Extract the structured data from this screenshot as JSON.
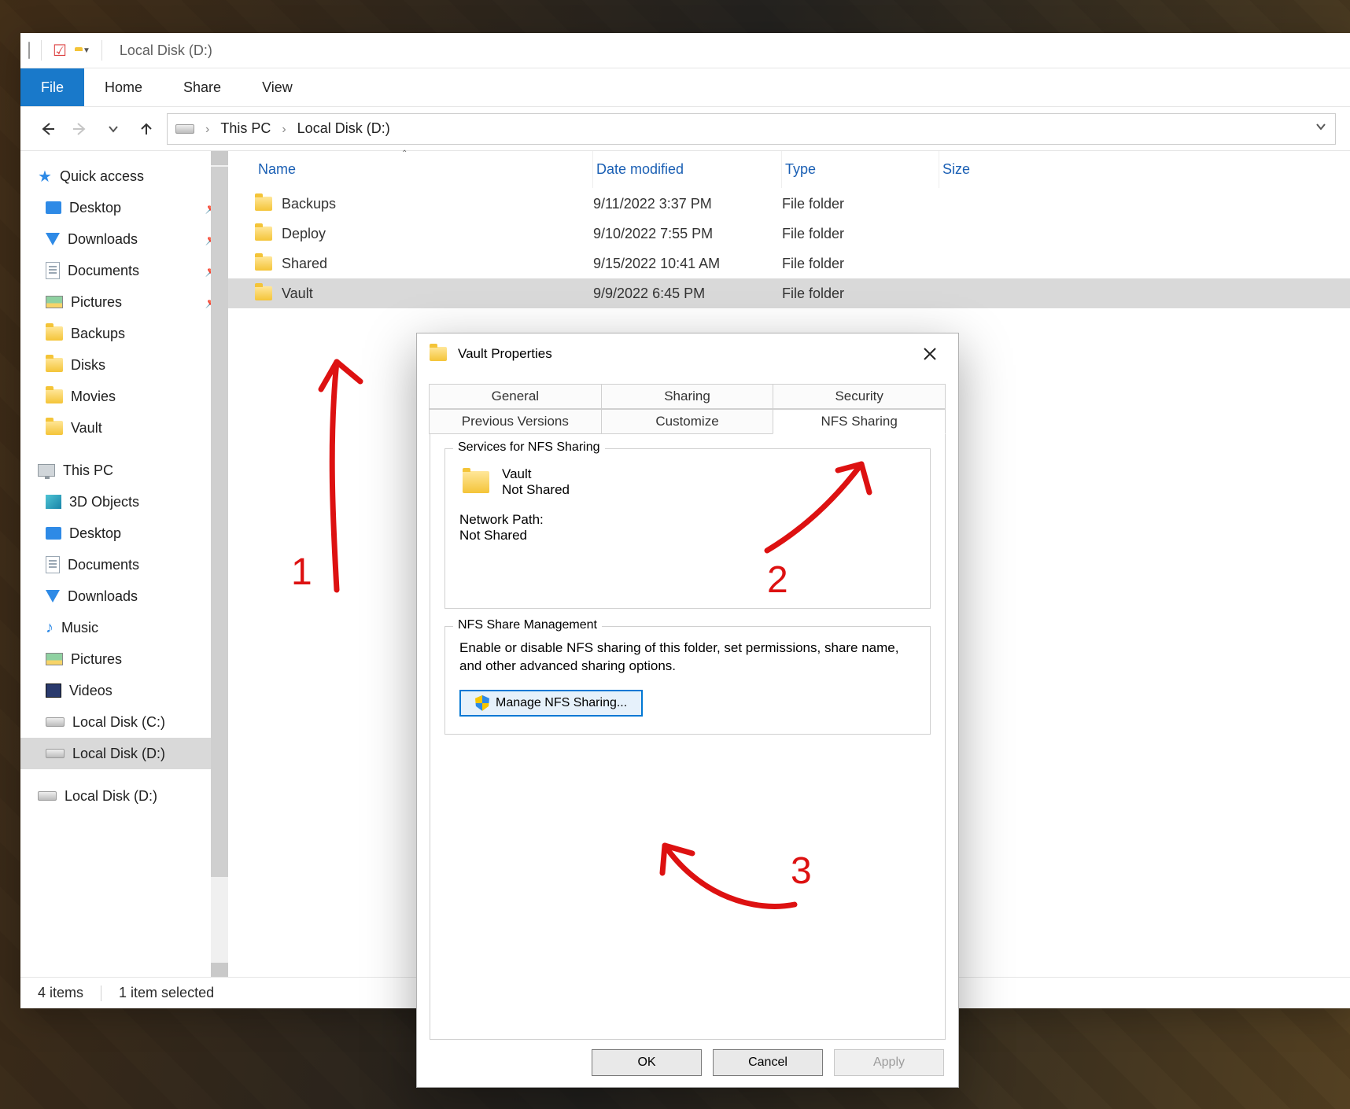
{
  "titlebar": {
    "title": "Local Disk (D:)"
  },
  "ribbon": {
    "file": "File",
    "home": "Home",
    "share": "Share",
    "view": "View"
  },
  "breadcrumb": {
    "root": "This PC",
    "current": "Local Disk (D:)"
  },
  "sidebar": {
    "quick_access": "Quick access",
    "pinned": [
      {
        "label": "Desktop"
      },
      {
        "label": "Downloads"
      },
      {
        "label": "Documents"
      },
      {
        "label": "Pictures"
      }
    ],
    "recent": [
      {
        "label": "Backups"
      },
      {
        "label": "Disks"
      },
      {
        "label": "Movies"
      },
      {
        "label": "Vault"
      }
    ],
    "this_pc": "This PC",
    "pc_items": [
      {
        "label": "3D Objects"
      },
      {
        "label": "Desktop"
      },
      {
        "label": "Documents"
      },
      {
        "label": "Downloads"
      },
      {
        "label": "Music"
      },
      {
        "label": "Pictures"
      },
      {
        "label": "Videos"
      },
      {
        "label": "Local Disk (C:)"
      },
      {
        "label": "Local Disk (D:)"
      }
    ],
    "extra_drive": "Local Disk (D:)"
  },
  "columns": {
    "name": "Name",
    "modified": "Date modified",
    "type": "Type",
    "size": "Size"
  },
  "files": [
    {
      "name": "Backups",
      "modified": "9/11/2022 3:37 PM",
      "type": "File folder"
    },
    {
      "name": "Deploy",
      "modified": "9/10/2022 7:55 PM",
      "type": "File folder"
    },
    {
      "name": "Shared",
      "modified": "9/15/2022 10:41 AM",
      "type": "File folder"
    },
    {
      "name": "Vault",
      "modified": "9/9/2022 6:45 PM",
      "type": "File folder"
    }
  ],
  "status": {
    "count": "4 items",
    "selection": "1 item selected"
  },
  "dialog": {
    "title": "Vault Properties",
    "tabs_row1": [
      "General",
      "Sharing",
      "Security"
    ],
    "tabs_row2": [
      "Previous Versions",
      "Customize",
      "NFS Sharing"
    ],
    "nfs": {
      "group1_title": "Services for NFS Sharing",
      "folder_name": "Vault",
      "folder_status": "Not Shared",
      "path_label": "Network Path:",
      "path_value": "Not Shared",
      "group2_title": "NFS Share Management",
      "group2_text": "Enable or disable NFS sharing of this folder, set permissions, share name, and other advanced sharing options.",
      "manage_btn": "Manage NFS Sharing..."
    },
    "buttons": {
      "ok": "OK",
      "cancel": "Cancel",
      "apply": "Apply"
    }
  },
  "annotations": {
    "n1": "1",
    "n2": "2",
    "n3": "3"
  }
}
